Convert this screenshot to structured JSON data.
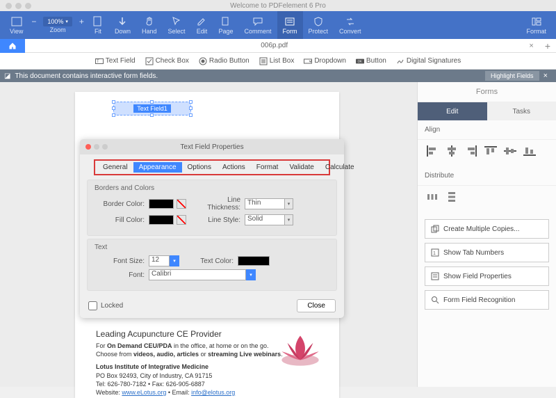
{
  "app": {
    "title": "Welcome to PDFelement 6 Pro"
  },
  "ribbon": {
    "view": "View",
    "zoom": "Zoom",
    "zoom_value": "100%",
    "fit": "Fit",
    "down": "Down",
    "hand": "Hand",
    "select": "Select",
    "edit": "Edit",
    "page": "Page",
    "comment": "Comment",
    "form": "Form",
    "protect": "Protect",
    "convert": "Convert",
    "format": "Format"
  },
  "file": {
    "name": "006p.pdf"
  },
  "formbar": {
    "text_field": "Text Field",
    "check_box": "Check Box",
    "radio_button": "Radio Button",
    "list_box": "List Box",
    "dropdown": "Dropdown",
    "button": "Button",
    "digital_sig": "Digital Signatures"
  },
  "warning": {
    "msg": "This document contains interactive form fields.",
    "highlight": "Highlight Fields"
  },
  "field": {
    "label": "Text Field1"
  },
  "dialog": {
    "title": "Text Field Properties",
    "tabs": {
      "general": "General",
      "appearance": "Appearance",
      "options": "Options",
      "actions": "Actions",
      "format": "Format",
      "validate": "Validate",
      "calculate": "Calculate"
    },
    "borders_colors": "Borders and Colors",
    "border_color": "Border Color:",
    "fill_color": "Fill Color:",
    "line_thickness": "Line Thickness:",
    "line_thickness_val": "Thin",
    "line_style": "Line Style:",
    "line_style_val": "Solid",
    "text_section": "Text",
    "font_size": "Font Size:",
    "font_size_val": "12",
    "text_color": "Text Color:",
    "font": "Font:",
    "font_val": "Calibri",
    "locked": "Locked",
    "close": "Close"
  },
  "doc": {
    "h1": "Leading Acupuncture CE Provider",
    "l1a": "For ",
    "l1b": "On Demand CEU/PDA",
    "l1c": " in the office, at home or on the go.",
    "l2a": "Choose from ",
    "l2b": "videos, audio, articles",
    "l2c": " or ",
    "l2d": "streaming Live webinars",
    "l2e": ".",
    "h2": "Lotus Institute of Integrative Medicine",
    "addr": "PO Box 92493, City of Industry, CA 91715",
    "tel": "Tel: 626-780-7182 • Fax: 626-905-6887",
    "web_label": "Website: ",
    "web": "www.eLotus.org",
    "email_label": " • Email: ",
    "email": "info@elotus.org"
  },
  "sidebar": {
    "header": "Forms",
    "edit": "Edit",
    "tasks": "Tasks",
    "align": "Align",
    "distribute": "Distribute",
    "a1": "Create Multiple Copies...",
    "a2": "Show Tab Numbers",
    "a3": "Show Field Properties",
    "a4": "Form Field Recognition"
  }
}
